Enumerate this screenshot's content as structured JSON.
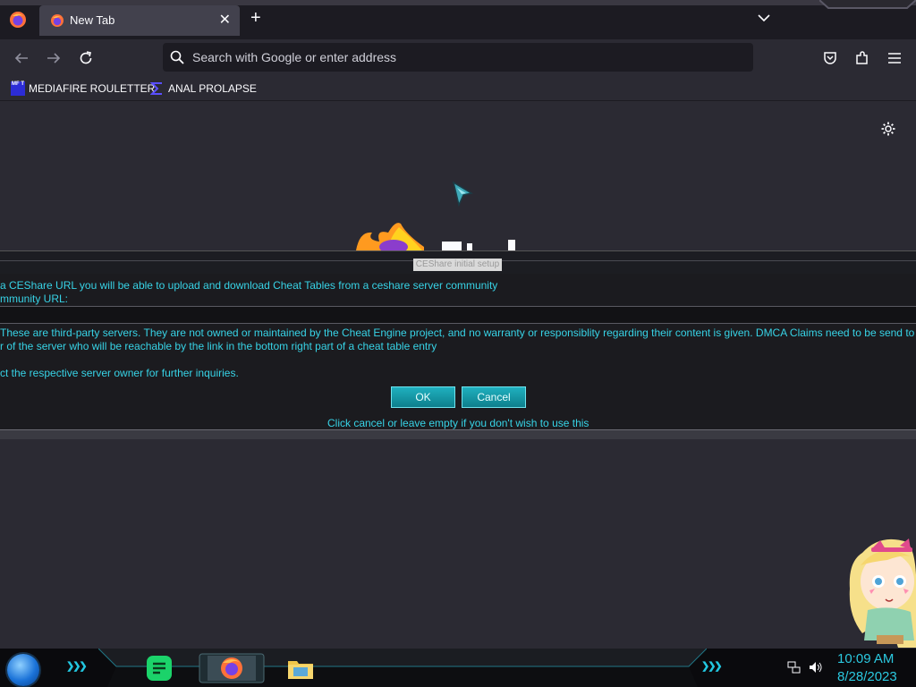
{
  "browser": {
    "tab": {
      "title": "New Tab",
      "close": "✕"
    },
    "new_tab": "+",
    "urlbar": {
      "placeholder": "Search with Google or enter address"
    },
    "bookmarks": [
      {
        "label": "MEDIAFIRE ROULETTER",
        "icon_text": "MF T"
      },
      {
        "label": "ANAL PROLAPSE"
      }
    ]
  },
  "dialog": {
    "title": "CEShare initial setup",
    "lines": [
      "a CEShare URL you will be able to upload and download Cheat Tables from a ceshare server community",
      "mmunity URL:",
      "These are third-party servers. They are not owned or maintained by the Cheat Engine project, and no warranty or responsiblity regarding their content is given.  DMCA Claims need to be send to th",
      "r of the server who will be reachable by the link in the bottom right part of a cheat table entry",
      "ct the respective server owner for further inquiries."
    ],
    "ok_label": "OK",
    "cancel_label": "Cancel",
    "footer": "Click cancel or leave empty if you don't wish to use this"
  },
  "taskbar": {
    "time": "10:09 AM",
    "date": "8/28/2023",
    "chevrons_left": "❯❯❯",
    "chevrons_right": "❯❯❯"
  }
}
